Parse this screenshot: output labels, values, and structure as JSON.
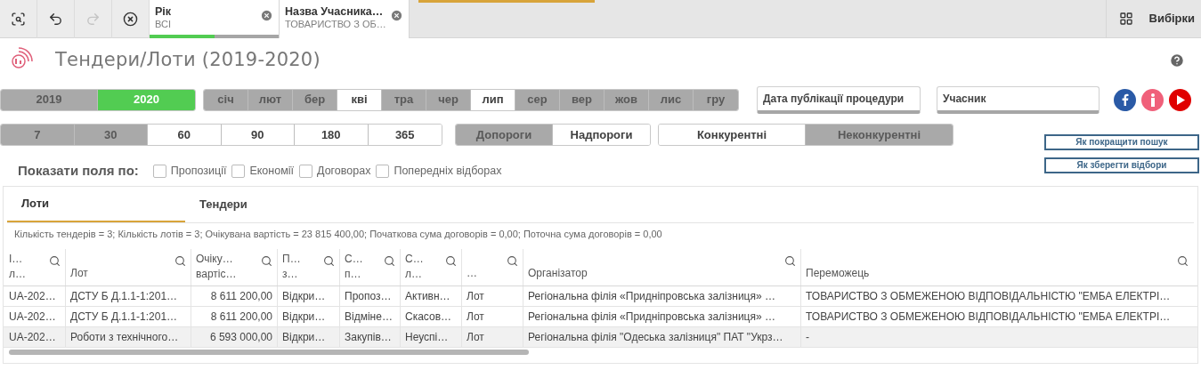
{
  "toolbar": {
    "tools": [
      {
        "kind": "lasso",
        "disabled": false
      },
      {
        "kind": "back",
        "disabled": false
      },
      {
        "kind": "forward",
        "disabled": true
      },
      {
        "kind": "clear",
        "disabled": false
      }
    ],
    "filters": [
      {
        "field": "Рік",
        "value": "ВСІ",
        "level": 0.5
      },
      {
        "field": "Назва Учасника…",
        "value": "ТОВАРИСТВО З ОБ…"
      }
    ],
    "selections_label": "Вибірки"
  },
  "title": "Тендери/Лоти (2019-2020)",
  "years": [
    {
      "label": "2019",
      "selected": false
    },
    {
      "label": "2020",
      "selected": true
    }
  ],
  "months": [
    {
      "label": "січ",
      "excluded": true
    },
    {
      "label": "лют",
      "excluded": true
    },
    {
      "label": "бер",
      "excluded": true
    },
    {
      "label": "кві",
      "excluded": false
    },
    {
      "label": "тра",
      "excluded": true
    },
    {
      "label": "чер",
      "excluded": true
    },
    {
      "label": "лип",
      "excluded": false
    },
    {
      "label": "сер",
      "excluded": true
    },
    {
      "label": "вер",
      "excluded": true
    },
    {
      "label": "жов",
      "excluded": true
    },
    {
      "label": "лис",
      "excluded": true
    },
    {
      "label": "гру",
      "excluded": true
    }
  ],
  "dropdowns": [
    "Дата публікації процедури",
    "Учасник"
  ],
  "days": [
    {
      "label": "7",
      "excluded": true
    },
    {
      "label": "30",
      "excluded": true
    },
    {
      "label": "60",
      "excluded": false
    },
    {
      "label": "90",
      "excluded": false
    },
    {
      "label": "180",
      "excluded": false
    },
    {
      "label": "365",
      "excluded": false
    }
  ],
  "thresholds": [
    {
      "label": "Допороги",
      "excluded": true
    },
    {
      "label": "Надпороги",
      "excluded": false
    }
  ],
  "competition": [
    {
      "label": "Конкурентні",
      "excluded": false
    },
    {
      "label": "Неконкурентні",
      "excluded": true
    }
  ],
  "help_links": [
    "Як покращити пошук",
    "Як зберегти відбори"
  ],
  "show_fields": {
    "label": "Показати поля по:",
    "options": [
      {
        "label": "Пропозиції",
        "checked": false
      },
      {
        "label": "Економії",
        "checked": false
      },
      {
        "label": "Договорах",
        "checked": false
      },
      {
        "label": "Попередніх відборах",
        "checked": false
      }
    ]
  },
  "tabs": [
    {
      "label": "Лоти",
      "selected": true
    },
    {
      "label": "Тендери",
      "selected": false
    }
  ],
  "summary": "Кількість тендерів = 3; Кількість лотів = 3; Очікувана вартість = 23 815 400,00; Початкова сума договорів = 0,00; Поточна сума договорів = 0,00",
  "table": {
    "columns": [
      {
        "label": "І…\nл…",
        "kind": "text"
      },
      {
        "label": "Лот",
        "kind": "text"
      },
      {
        "label": "Очіку…\nвартіс…",
        "kind": "number"
      },
      {
        "label": "П…\nз…",
        "kind": "text"
      },
      {
        "label": "С…\nп…",
        "kind": "text"
      },
      {
        "label": "С…\nл…",
        "kind": "text"
      },
      {
        "label": "…",
        "kind": "link"
      },
      {
        "label": "Організатор",
        "kind": "text"
      },
      {
        "label": "Переможець",
        "kind": "text"
      }
    ],
    "rows": [
      {
        "highlighted": false,
        "cells": [
          "UA-202…",
          "ДСТУ Б Д.1.1-1:201…",
          "8 611 200,00",
          "Відкри…",
          "Пропоз…",
          "Активн…",
          "Лот",
          "Регіональна філія «Придніпровська залізниця» …",
          "ТОВАРИСТВО З ОБМЕЖЕНОЮ ВІДПОВІДАЛЬНІСТЮ \"ЕМБА ЕЛЕКТРІ…"
        ]
      },
      {
        "highlighted": false,
        "cells": [
          "UA-202…",
          "ДСТУ Б Д.1.1-1:201…",
          "8 611 200,00",
          "Відкри…",
          "Відміне…",
          "Скасов…",
          "Лот",
          "Регіональна філія «Придніпровська залізниця» …",
          "ТОВАРИСТВО З ОБМЕЖЕНОЮ ВІДПОВІДАЛЬНІСТЮ \"ЕМБА ЕЛЕКТРІ…"
        ]
      },
      {
        "highlighted": true,
        "cells": [
          "UA-202…",
          "Роботи з технічного…",
          "6 593 000,00",
          "Відкри…",
          "Закупів…",
          "Неуспі…",
          "Лот",
          "Регіональна філія \"Одеська залізниця\" ПАТ \"Укрз…",
          "-"
        ]
      }
    ]
  }
}
